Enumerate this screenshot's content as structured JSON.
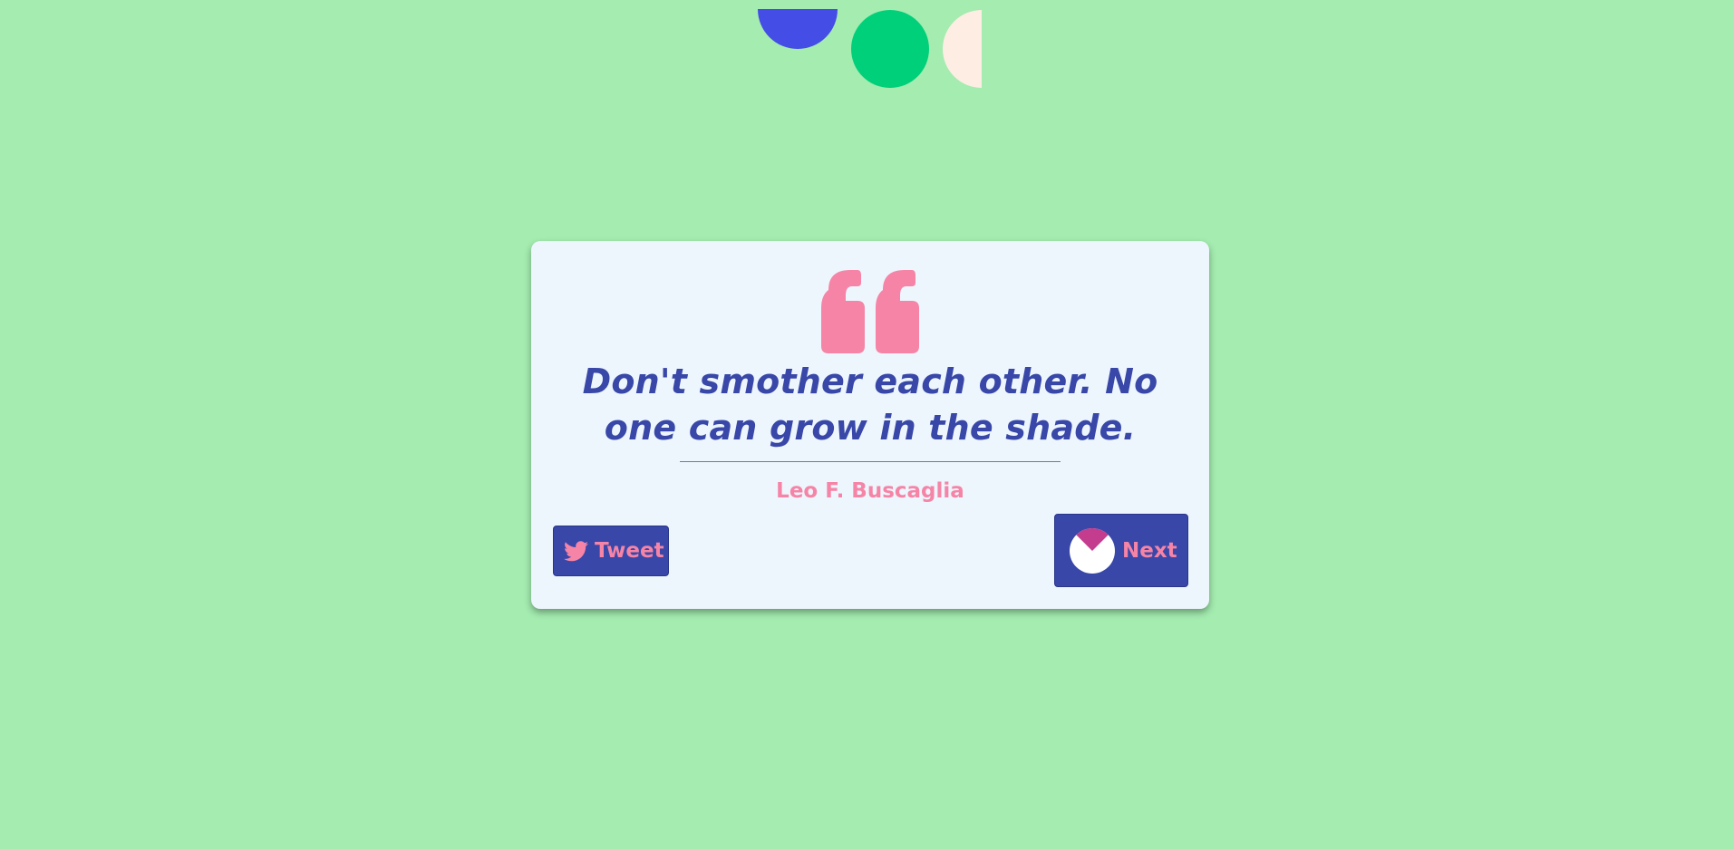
{
  "quote": {
    "text": "Don't smother each other. No one can grow in the shade.",
    "author": "Leo F. Buscaglia"
  },
  "actions": {
    "tweet_label": "Tweet",
    "next_label": "Next"
  },
  "icons": {
    "quote": "quote-mark-icon",
    "tweet": "twitter-bird-icon",
    "next": "loading-spinner-icon"
  },
  "colors": {
    "background": "#a4ecb0",
    "card": "#edf6fd",
    "accent_blue": "#3847a8",
    "accent_pink": "#f584a6",
    "shape_blue": "#444de6",
    "shape_green": "#00d07a",
    "shape_cream": "#fdede3"
  }
}
